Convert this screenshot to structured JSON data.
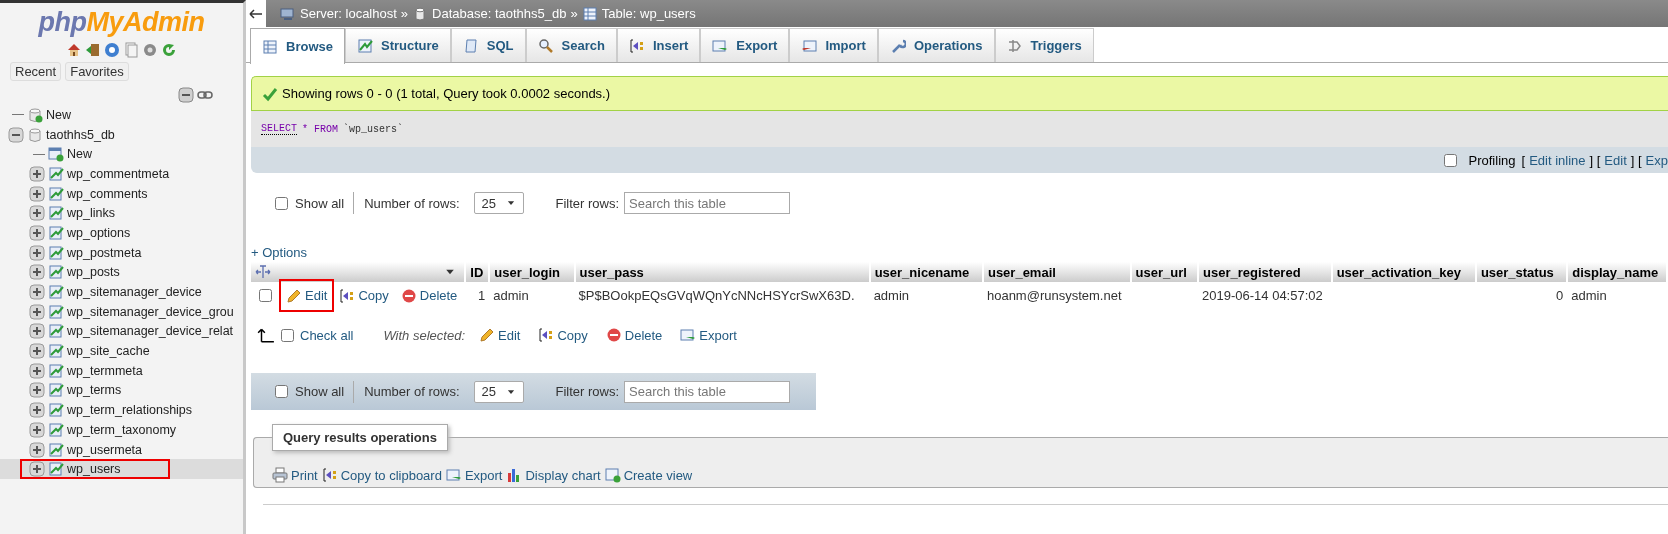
{
  "sidebar": {
    "logo": [
      "php",
      "MyAdmin"
    ],
    "buttons": [
      "Recent",
      "Favorites"
    ],
    "tree": [
      {
        "kind": "new",
        "label": "New"
      },
      {
        "kind": "database",
        "label": "taothhs5_db",
        "expanded": true,
        "children": [
          {
            "kind": "new",
            "label": "New"
          },
          {
            "kind": "table",
            "label": "wp_commentmeta",
            "expanded": false,
            "selected": false,
            "highlighted": false
          },
          {
            "kind": "table",
            "label": "wp_comments",
            "expanded": false,
            "selected": false,
            "highlighted": false
          },
          {
            "kind": "table",
            "label": "wp_links",
            "expanded": false,
            "selected": false,
            "highlighted": false
          },
          {
            "kind": "table",
            "label": "wp_options",
            "expanded": false,
            "selected": false,
            "highlighted": false
          },
          {
            "kind": "table",
            "label": "wp_postmeta",
            "expanded": false,
            "selected": false,
            "highlighted": false
          },
          {
            "kind": "table",
            "label": "wp_posts",
            "expanded": false,
            "selected": false,
            "highlighted": false
          },
          {
            "kind": "table",
            "label": "wp_sitemanager_device",
            "expanded": false,
            "selected": false,
            "highlighted": false
          },
          {
            "kind": "table",
            "label": "wp_sitemanager_device_grou",
            "expanded": false,
            "selected": false,
            "highlighted": false
          },
          {
            "kind": "table",
            "label": "wp_sitemanager_device_relat",
            "expanded": false,
            "selected": false,
            "highlighted": false
          },
          {
            "kind": "table",
            "label": "wp_site_cache",
            "expanded": false,
            "selected": false,
            "highlighted": false
          },
          {
            "kind": "table",
            "label": "wp_termmeta",
            "expanded": false,
            "selected": false,
            "highlighted": false
          },
          {
            "kind": "table",
            "label": "wp_terms",
            "expanded": false,
            "selected": false,
            "highlighted": false
          },
          {
            "kind": "table",
            "label": "wp_term_relationships",
            "expanded": false,
            "selected": false,
            "highlighted": false
          },
          {
            "kind": "table",
            "label": "wp_term_taxonomy",
            "expanded": false,
            "selected": false,
            "highlighted": false
          },
          {
            "kind": "table",
            "label": "wp_usermeta",
            "expanded": false,
            "selected": false,
            "highlighted": false
          },
          {
            "kind": "table",
            "label": "wp_users",
            "expanded": false,
            "selected": true,
            "highlighted": true
          }
        ]
      }
    ]
  },
  "breadcrumb": [
    "Server: localhost",
    "»",
    "Database: taothhs5_db",
    "»",
    "Table: wp_users"
  ],
  "tabs": [
    {
      "label": "Browse",
      "selected": true
    },
    {
      "label": "Structure",
      "selected": false
    },
    {
      "label": "SQL",
      "selected": false
    },
    {
      "label": "Search",
      "selected": false
    },
    {
      "label": "Insert",
      "selected": false
    },
    {
      "label": "Export",
      "selected": false
    },
    {
      "label": "Import",
      "selected": false
    },
    {
      "label": "Operations",
      "selected": false
    },
    {
      "label": "Triggers",
      "selected": false
    }
  ],
  "message": "Showing rows 0 - 0 (1 total, Query took 0.0002 seconds.)",
  "sql": [
    "SELECT",
    "* FROM",
    "`wp_users`"
  ],
  "profiling": {
    "checked": false,
    "label": "Profiling",
    "parts": [
      {
        "kind": "text",
        "text": "["
      },
      {
        "kind": "link",
        "text": "Edit inline"
      },
      {
        "kind": "text",
        "text": "] ["
      },
      {
        "kind": "link",
        "text": "Edit"
      },
      {
        "kind": "text",
        "text": "] ["
      },
      {
        "kind": "link",
        "text": "Exp"
      }
    ]
  },
  "navigation": [
    {
      "show_all": {
        "label": "Show all",
        "checked": false
      },
      "rows_label": "Number of rows:",
      "rows_value": "25",
      "filter_label": "Filter rows:",
      "placeholder": "Search this table"
    },
    {
      "show_all": {
        "label": "Show all",
        "checked": false
      },
      "rows_label": "Number of rows:",
      "rows_value": "25",
      "filter_label": "Filter rows:",
      "placeholder": "Search this table"
    }
  ],
  "options_link": "+ Options",
  "table": {
    "columns": [
      "ID",
      "user_login",
      "user_pass",
      "user_nicename",
      "user_email",
      "user_url",
      "user_registered",
      "user_activation_key",
      "user_status",
      "display_name"
    ],
    "rows": [
      {
        "checked": false,
        "actions": [
          {
            "label": "Edit",
            "highlighted": true
          },
          {
            "label": "Copy",
            "highlighted": false
          },
          {
            "label": "Delete",
            "highlighted": false
          }
        ],
        "cells": [
          "1",
          "admin",
          "$P$BOokpEQsGVqWQnYcNNcHSYcrSwX63D.",
          "admin",
          "hoanm@runsystem.net",
          "",
          "2019-06-14 04:57:02",
          "",
          "0",
          "admin"
        ]
      }
    ]
  },
  "bulk": {
    "check_all": {
      "label": "Check all",
      "checked": false
    },
    "with_selected": "With selected:",
    "actions": [
      "Edit",
      "Copy",
      "Delete",
      "Export"
    ]
  },
  "operations": {
    "legend": "Query results operations",
    "links": [
      "Print",
      "Copy to clipboard",
      "Export",
      "Display chart",
      "Create view"
    ]
  }
}
